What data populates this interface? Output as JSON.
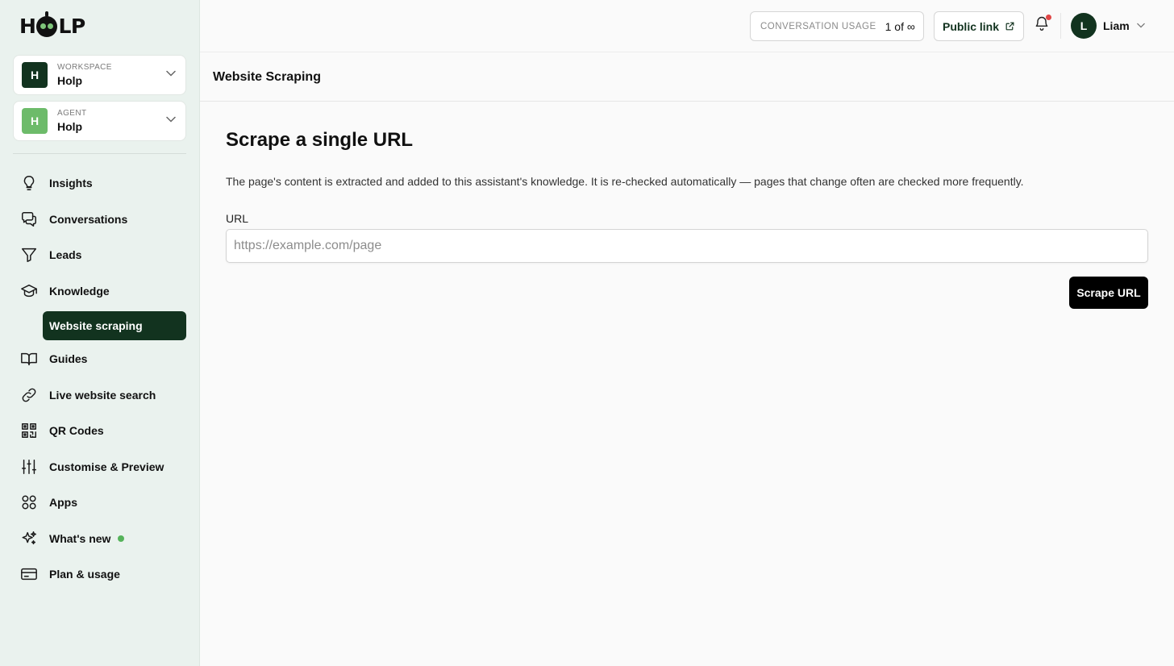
{
  "app": {
    "logo_text_left": "H",
    "logo_text_right": "LP"
  },
  "sidebar": {
    "workspace": {
      "caption": "WORKSPACE",
      "value": "Holp",
      "initial": "H",
      "color": "#12331f"
    },
    "agent": {
      "caption": "AGENT",
      "value": "Holp",
      "initial": "H",
      "color": "#6dbb6a"
    },
    "items": [
      {
        "label": "Insights",
        "icon": "lightbulb-icon"
      },
      {
        "label": "Conversations",
        "icon": "chat-bubbles-icon"
      },
      {
        "label": "Leads",
        "icon": "funnel-icon"
      },
      {
        "label": "Knowledge",
        "icon": "graduation-cap-icon"
      },
      {
        "label": "Guides",
        "icon": "book-open-icon"
      },
      {
        "label": "Live website search",
        "icon": "link-icon"
      },
      {
        "label": "QR Codes",
        "icon": "qr-code-icon"
      },
      {
        "label": "Customise & Preview",
        "icon": "sliders-icon"
      },
      {
        "label": "Apps",
        "icon": "apps-grid-icon"
      },
      {
        "label": "What's new",
        "icon": "sparkles-icon"
      },
      {
        "label": "Plan & usage",
        "icon": "credit-card-icon"
      }
    ],
    "active_subitem": "Website scraping"
  },
  "topbar": {
    "usage_caption": "CONVERSATION USAGE",
    "usage_value": "1 of ∞",
    "public_link_label": "Public link",
    "user_initial": "L",
    "user_name": "Liam"
  },
  "page": {
    "title": "Website Scraping",
    "heading": "Scrape a single URL",
    "description": "The page's content is extracted and added to this assistant's knowledge. It is re-checked automatically — pages that change often are checked more frequently.",
    "url_label": "URL",
    "url_placeholder": "https://example.com/page",
    "url_value": "",
    "submit_label": "Scrape URL"
  }
}
